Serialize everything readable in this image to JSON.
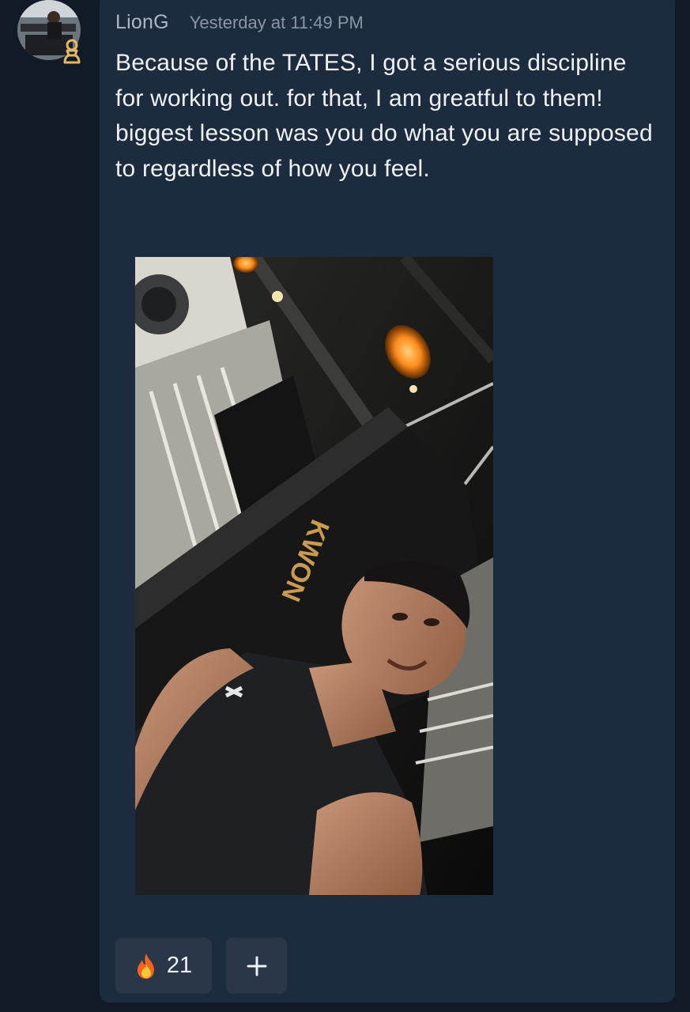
{
  "post": {
    "author": {
      "name": "LionG",
      "avatar_icon": "profile-photo",
      "badge_icon": "pawn-icon",
      "badge_color": "#e3b86a"
    },
    "timestamp": "Yesterday at 11:49 PM",
    "message": "Because of the TATES, I got a serious discipline for working out. for that, I am greatful to them! biggest lesson was you do what you are supposed to regardless of how you feel.",
    "attachment": {
      "type": "image",
      "bag_brand": "KWON"
    },
    "reactions": [
      {
        "emoji_icon": "fire-icon",
        "count": "21"
      }
    ],
    "add_reaction_icon": "plus-icon"
  },
  "colors": {
    "background": "#111b28",
    "card": "#1d2b3e",
    "chip": "#2a3749",
    "text": "#eef1f5",
    "muted": "#8996a6"
  }
}
